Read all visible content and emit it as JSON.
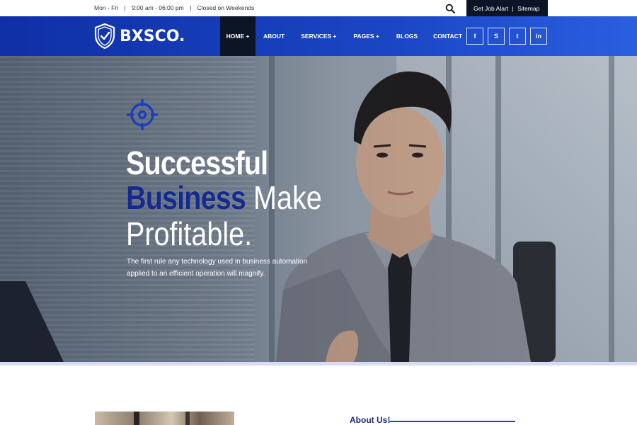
{
  "topbar": {
    "days": "Mon - Fri",
    "sep1": "|",
    "hours": "9:00 am - 06:00 pm",
    "sep2": "|",
    "closed": "Closed on Weekends",
    "job_alert": "Get Job Alart",
    "sep3": "|",
    "sitemap": "Sitemap"
  },
  "nav": {
    "brand": "BXSCO.",
    "items": [
      {
        "label": "HOME +"
      },
      {
        "label": "ABOUT"
      },
      {
        "label": "SERVICES +"
      },
      {
        "label": "PAGES +"
      },
      {
        "label": "BLOGS"
      },
      {
        "label": "CONTACT"
      }
    ],
    "social": [
      {
        "icon": "facebook-icon",
        "glyph": "f"
      },
      {
        "icon": "skype-icon",
        "glyph": "S"
      },
      {
        "icon": "twitter-icon",
        "glyph": "t"
      },
      {
        "icon": "linkedin-icon",
        "glyph": "in"
      }
    ]
  },
  "hero": {
    "line1": "Successful",
    "line2_accent": "Business",
    "line2_rest": " Make",
    "line3": "Profitable.",
    "lead_1": "The first rule any technology used in business automation",
    "lead_2": "applied to an efficient operation will magnify."
  },
  "about": {
    "title": "About Us!"
  },
  "colors": {
    "nav_start": "#0f2fa6",
    "nav_end": "#2a5fe0",
    "dark": "#0b1526",
    "accent": "#142a8f"
  }
}
